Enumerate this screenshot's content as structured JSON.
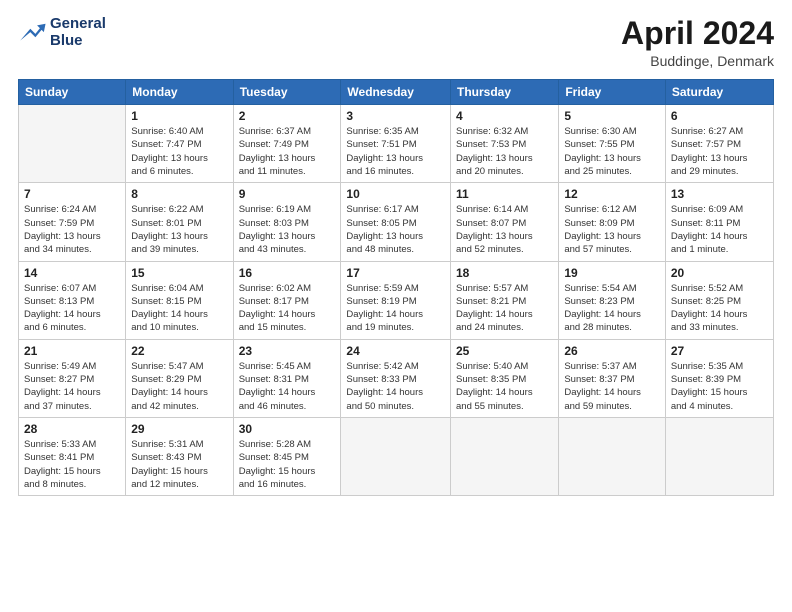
{
  "header": {
    "logo_line1": "General",
    "logo_line2": "Blue",
    "title": "April 2024",
    "subtitle": "Buddinge, Denmark"
  },
  "weekdays": [
    "Sunday",
    "Monday",
    "Tuesday",
    "Wednesday",
    "Thursday",
    "Friday",
    "Saturday"
  ],
  "weeks": [
    [
      {
        "day": "",
        "info": ""
      },
      {
        "day": "1",
        "info": "Sunrise: 6:40 AM\nSunset: 7:47 PM\nDaylight: 13 hours\nand 6 minutes."
      },
      {
        "day": "2",
        "info": "Sunrise: 6:37 AM\nSunset: 7:49 PM\nDaylight: 13 hours\nand 11 minutes."
      },
      {
        "day": "3",
        "info": "Sunrise: 6:35 AM\nSunset: 7:51 PM\nDaylight: 13 hours\nand 16 minutes."
      },
      {
        "day": "4",
        "info": "Sunrise: 6:32 AM\nSunset: 7:53 PM\nDaylight: 13 hours\nand 20 minutes."
      },
      {
        "day": "5",
        "info": "Sunrise: 6:30 AM\nSunset: 7:55 PM\nDaylight: 13 hours\nand 25 minutes."
      },
      {
        "day": "6",
        "info": "Sunrise: 6:27 AM\nSunset: 7:57 PM\nDaylight: 13 hours\nand 29 minutes."
      }
    ],
    [
      {
        "day": "7",
        "info": "Sunrise: 6:24 AM\nSunset: 7:59 PM\nDaylight: 13 hours\nand 34 minutes."
      },
      {
        "day": "8",
        "info": "Sunrise: 6:22 AM\nSunset: 8:01 PM\nDaylight: 13 hours\nand 39 minutes."
      },
      {
        "day": "9",
        "info": "Sunrise: 6:19 AM\nSunset: 8:03 PM\nDaylight: 13 hours\nand 43 minutes."
      },
      {
        "day": "10",
        "info": "Sunrise: 6:17 AM\nSunset: 8:05 PM\nDaylight: 13 hours\nand 48 minutes."
      },
      {
        "day": "11",
        "info": "Sunrise: 6:14 AM\nSunset: 8:07 PM\nDaylight: 13 hours\nand 52 minutes."
      },
      {
        "day": "12",
        "info": "Sunrise: 6:12 AM\nSunset: 8:09 PM\nDaylight: 13 hours\nand 57 minutes."
      },
      {
        "day": "13",
        "info": "Sunrise: 6:09 AM\nSunset: 8:11 PM\nDaylight: 14 hours\nand 1 minute."
      }
    ],
    [
      {
        "day": "14",
        "info": "Sunrise: 6:07 AM\nSunset: 8:13 PM\nDaylight: 14 hours\nand 6 minutes."
      },
      {
        "day": "15",
        "info": "Sunrise: 6:04 AM\nSunset: 8:15 PM\nDaylight: 14 hours\nand 10 minutes."
      },
      {
        "day": "16",
        "info": "Sunrise: 6:02 AM\nSunset: 8:17 PM\nDaylight: 14 hours\nand 15 minutes."
      },
      {
        "day": "17",
        "info": "Sunrise: 5:59 AM\nSunset: 8:19 PM\nDaylight: 14 hours\nand 19 minutes."
      },
      {
        "day": "18",
        "info": "Sunrise: 5:57 AM\nSunset: 8:21 PM\nDaylight: 14 hours\nand 24 minutes."
      },
      {
        "day": "19",
        "info": "Sunrise: 5:54 AM\nSunset: 8:23 PM\nDaylight: 14 hours\nand 28 minutes."
      },
      {
        "day": "20",
        "info": "Sunrise: 5:52 AM\nSunset: 8:25 PM\nDaylight: 14 hours\nand 33 minutes."
      }
    ],
    [
      {
        "day": "21",
        "info": "Sunrise: 5:49 AM\nSunset: 8:27 PM\nDaylight: 14 hours\nand 37 minutes."
      },
      {
        "day": "22",
        "info": "Sunrise: 5:47 AM\nSunset: 8:29 PM\nDaylight: 14 hours\nand 42 minutes."
      },
      {
        "day": "23",
        "info": "Sunrise: 5:45 AM\nSunset: 8:31 PM\nDaylight: 14 hours\nand 46 minutes."
      },
      {
        "day": "24",
        "info": "Sunrise: 5:42 AM\nSunset: 8:33 PM\nDaylight: 14 hours\nand 50 minutes."
      },
      {
        "day": "25",
        "info": "Sunrise: 5:40 AM\nSunset: 8:35 PM\nDaylight: 14 hours\nand 55 minutes."
      },
      {
        "day": "26",
        "info": "Sunrise: 5:37 AM\nSunset: 8:37 PM\nDaylight: 14 hours\nand 59 minutes."
      },
      {
        "day": "27",
        "info": "Sunrise: 5:35 AM\nSunset: 8:39 PM\nDaylight: 15 hours\nand 4 minutes."
      }
    ],
    [
      {
        "day": "28",
        "info": "Sunrise: 5:33 AM\nSunset: 8:41 PM\nDaylight: 15 hours\nand 8 minutes."
      },
      {
        "day": "29",
        "info": "Sunrise: 5:31 AM\nSunset: 8:43 PM\nDaylight: 15 hours\nand 12 minutes."
      },
      {
        "day": "30",
        "info": "Sunrise: 5:28 AM\nSunset: 8:45 PM\nDaylight: 15 hours\nand 16 minutes."
      },
      {
        "day": "",
        "info": ""
      },
      {
        "day": "",
        "info": ""
      },
      {
        "day": "",
        "info": ""
      },
      {
        "day": "",
        "info": ""
      }
    ]
  ]
}
